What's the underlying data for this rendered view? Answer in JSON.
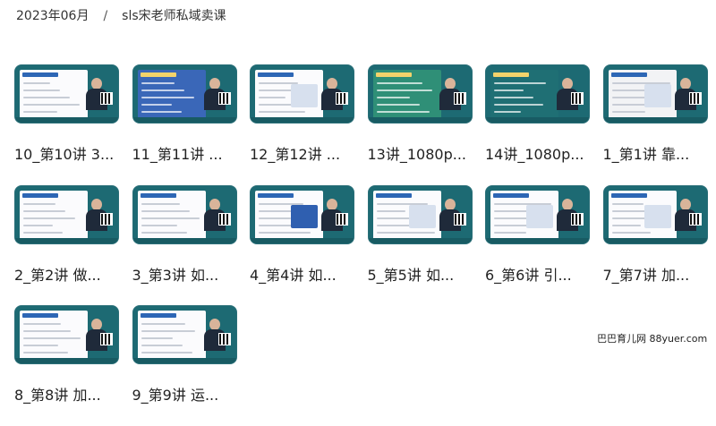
{
  "breadcrumb": {
    "month": "2023年06月",
    "separator": "/",
    "folder": "sls宋老师私域卖课"
  },
  "items": [
    {
      "label": "10_第10讲 3...",
      "variant": "light"
    },
    {
      "label": "11_第11讲 ...",
      "variant": "blue"
    },
    {
      "label": "12_第12讲 ...",
      "variant": "light"
    },
    {
      "label": "13讲_1080p...",
      "variant": "green"
    },
    {
      "label": "14讲_1080p...",
      "variant": "teal"
    },
    {
      "label": "1_第1讲 靠...",
      "variant": "portrait"
    },
    {
      "label": "2_第2讲 做...",
      "variant": "light"
    },
    {
      "label": "3_第3讲 如...",
      "variant": "light"
    },
    {
      "label": "4_第4讲 如...",
      "variant": "light"
    },
    {
      "label": "5_第5讲 如...",
      "variant": "light"
    },
    {
      "label": "6_第6讲 引...",
      "variant": "light"
    },
    {
      "label": "7_第7讲 加...",
      "variant": "light"
    },
    {
      "label": "8_第8讲 加...",
      "variant": "light"
    },
    {
      "label": "9_第9讲 运...",
      "variant": "light"
    }
  ],
  "watermark": "巴巴育儿网 88yuer.com",
  "colors": {
    "frame": "#1d6a73",
    "slide_light": "#fbfbfd",
    "slide_blue": "#3a67b8",
    "slide_green": "#2f8f77",
    "slide_teal": "#1f6f74"
  }
}
